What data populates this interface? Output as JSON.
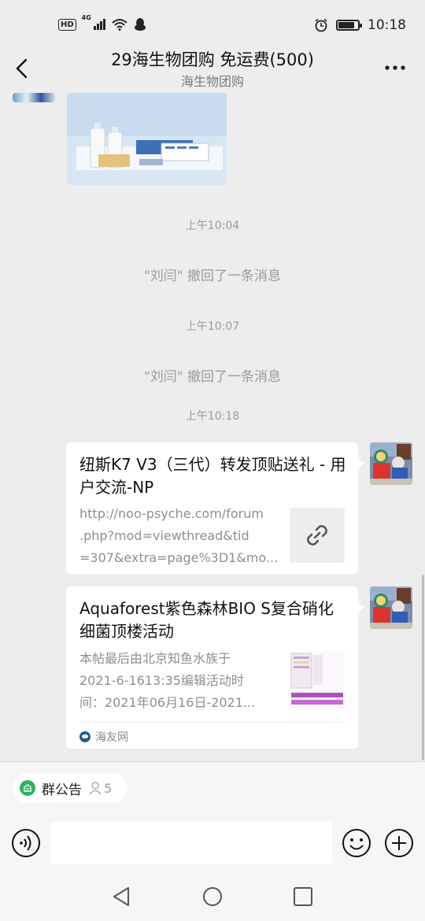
{
  "status_bar": {
    "network": "4G",
    "hd": "HD",
    "time": "10:18",
    "battery_level": 0.85
  },
  "header": {
    "title": "29海生物团购  免运费(500)",
    "subtitle": "海生物团购"
  },
  "chat": {
    "messages": [
      {
        "type": "time",
        "text": "上午10:04"
      },
      {
        "type": "system",
        "text": "\"刘闫\" 撤回了一条消息"
      },
      {
        "type": "time",
        "text": "上午10:07"
      },
      {
        "type": "system",
        "text": "\"刘闫\" 撤回了一条消息"
      },
      {
        "type": "time",
        "text": "上午10:18"
      }
    ],
    "link_card_1": {
      "title": "纽斯K7 V3（三代）转发顶贴送礼 - 用户交流-NP",
      "desc_lines": [
        "http://noo-psyche.com/forum",
        ".php?mod=viewthread&tid",
        "=307&extra=page%3D1&mo..."
      ]
    },
    "link_card_2": {
      "title": "Aquaforest紫色森林BIO S复合硝化细菌顶楼活动",
      "desc_lines": [
        "本帖最后由北京知鱼水族于",
        "2021-6-1613:35编辑活动时",
        "间：2021年06月16日-2021..."
      ],
      "source": "海友网"
    }
  },
  "bottom": {
    "notice_label": "群公告",
    "member_count": "5"
  },
  "colors": {
    "background": "#ededed",
    "notice_green": "#2fb35d",
    "source_blue": "#1d5c8f"
  }
}
